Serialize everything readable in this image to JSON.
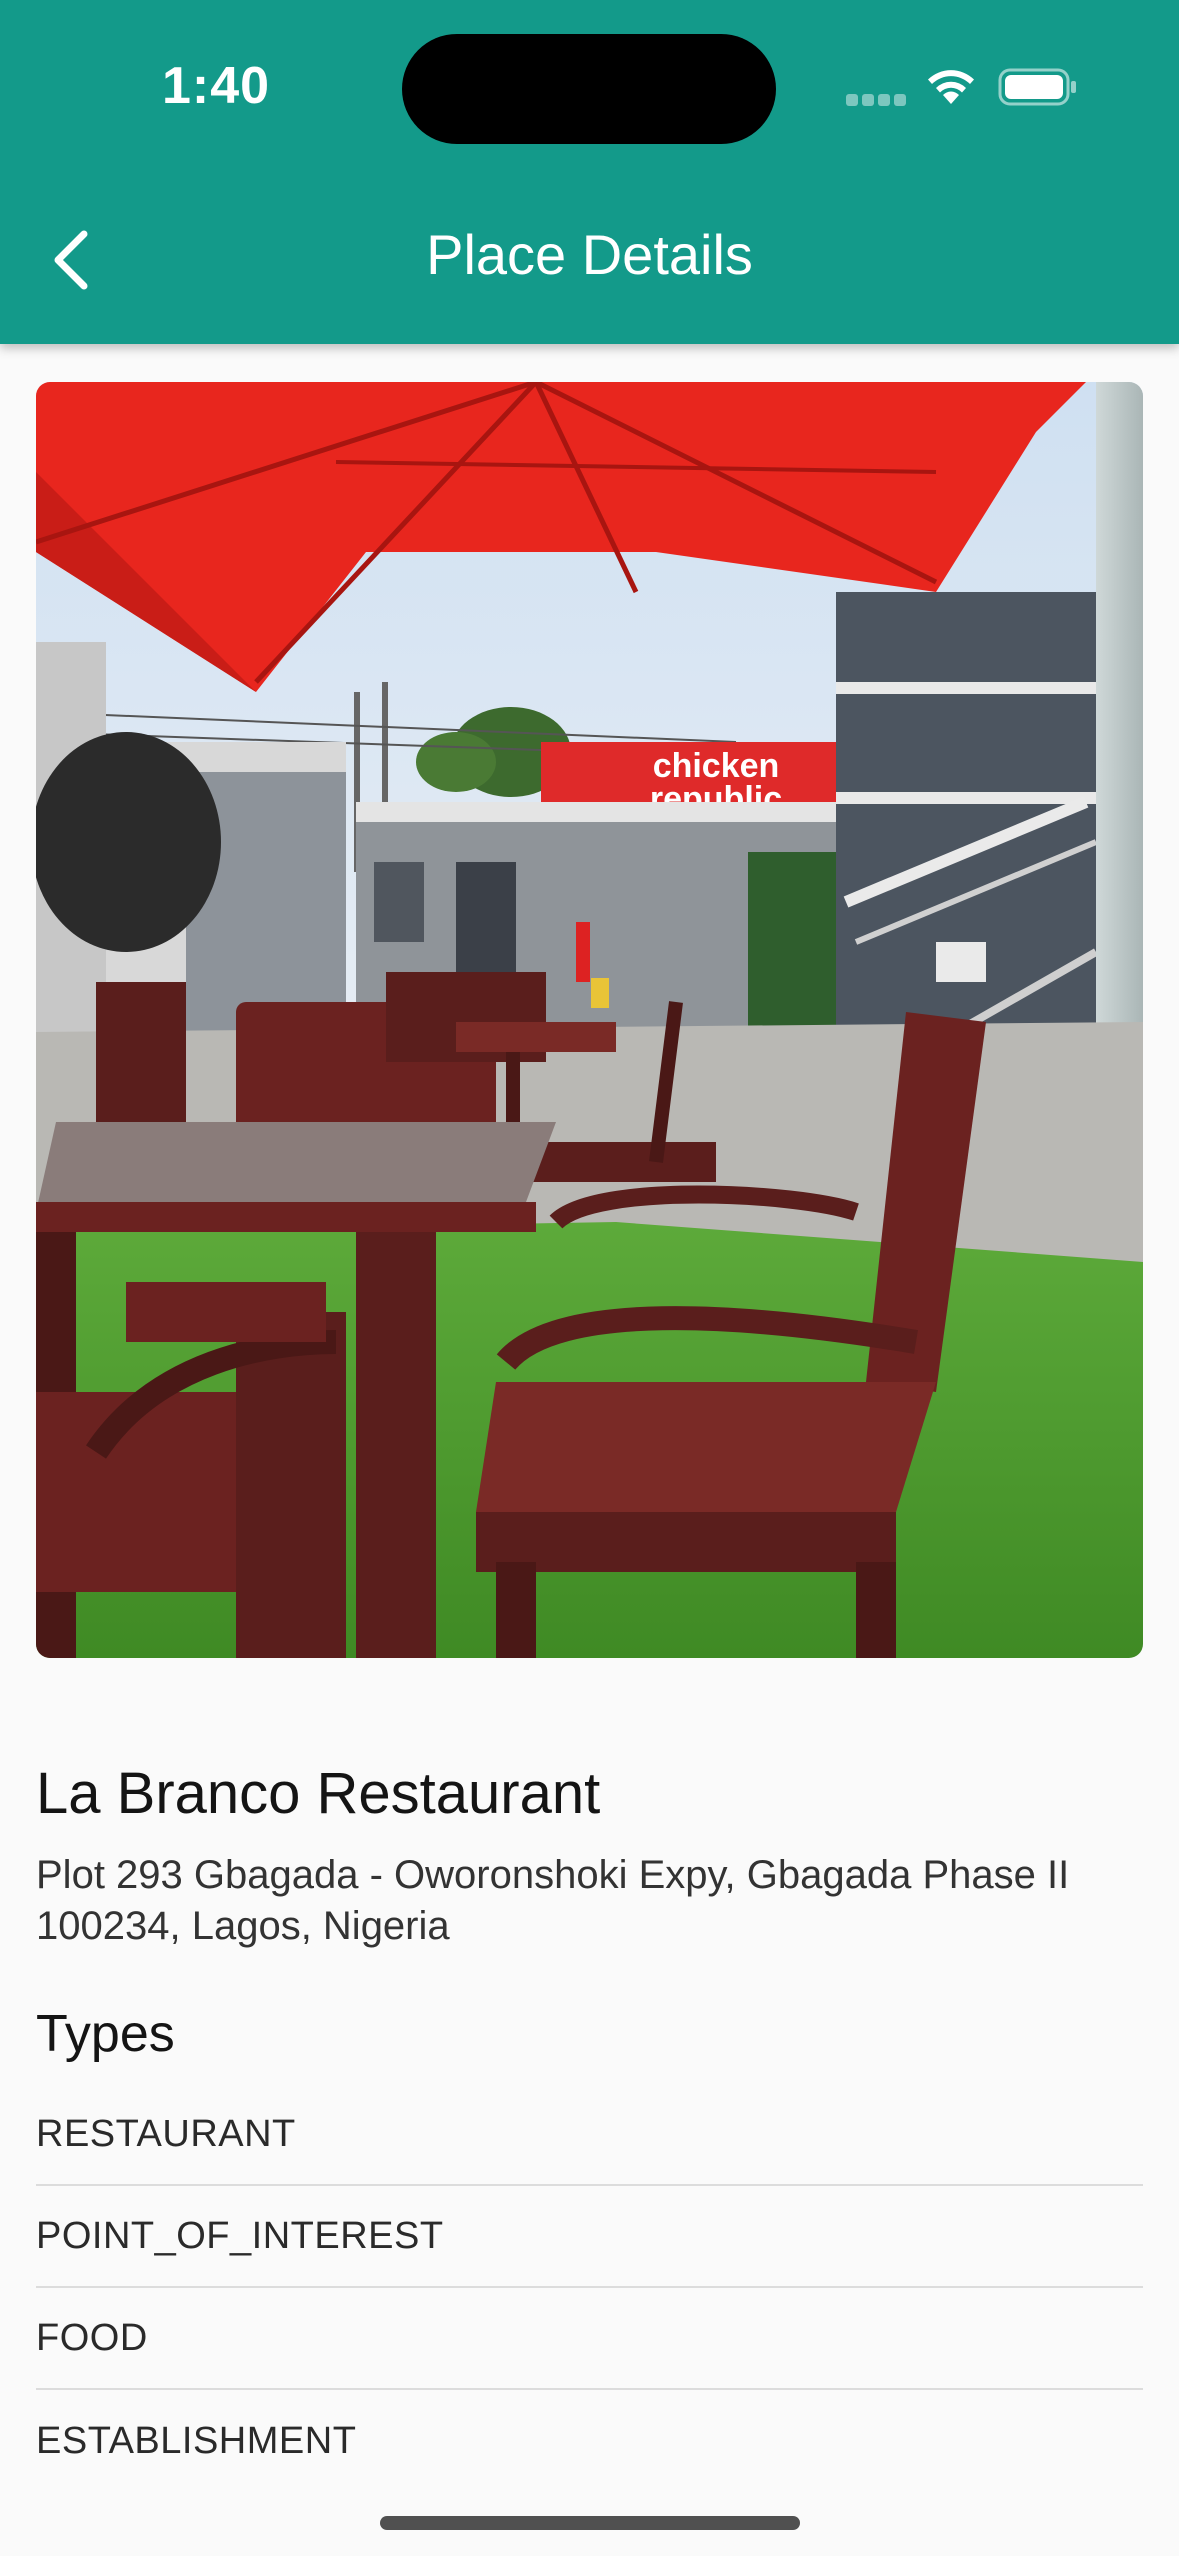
{
  "status_bar": {
    "time": "1:40"
  },
  "app_bar": {
    "title": "Place Details"
  },
  "place": {
    "photo_sign_line1": "chicken",
    "photo_sign_line2": "republic",
    "name": "La Branco Restaurant",
    "address": "Plot 293 Gbagada - Oworonshoki Expy, Gbagada Phase II 100234, Lagos, Nigeria"
  },
  "types": {
    "heading": "Types",
    "items": [
      "RESTAURANT",
      "POINT_OF_INTEREST",
      "FOOD",
      "ESTABLISHMENT"
    ]
  },
  "colors": {
    "app_bar": "#139a8a",
    "background": "#fafafa",
    "umbrella": "#e8261e",
    "sign": "#df2a2a",
    "grass": "#4a9a2c"
  }
}
